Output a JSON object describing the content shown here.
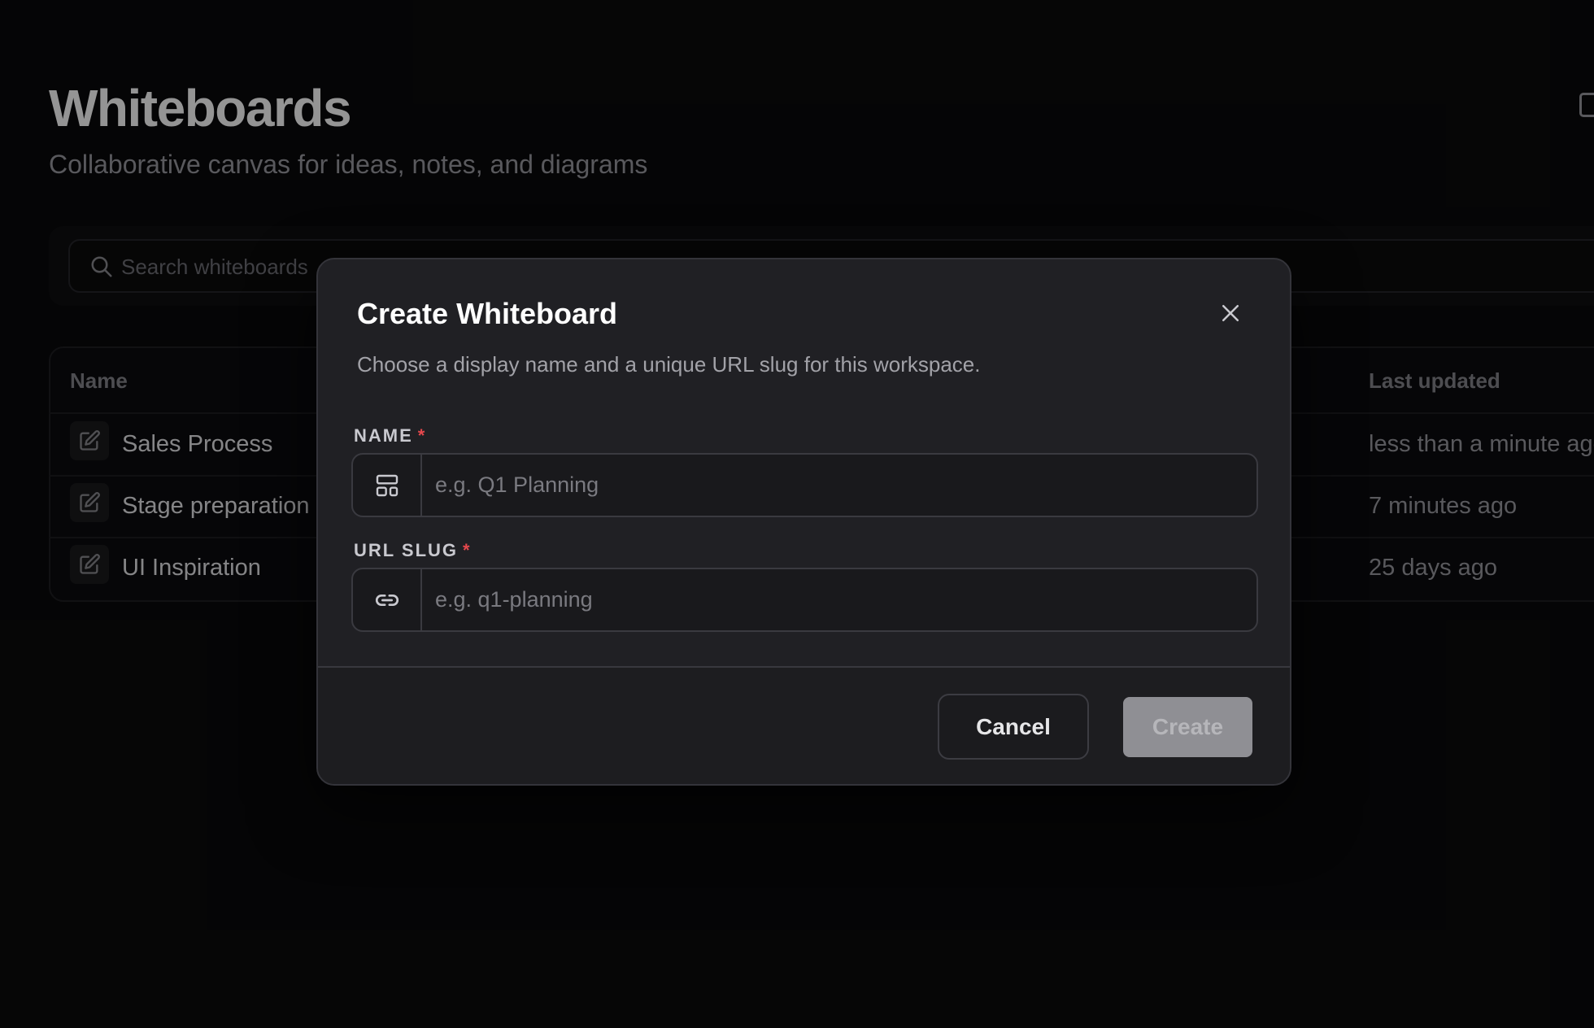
{
  "page": {
    "title": "Whiteboards",
    "subtitle": "Collaborative canvas for ideas, notes, and diagrams"
  },
  "search": {
    "placeholder": "Search whiteboards"
  },
  "table": {
    "columns": {
      "name": "Name",
      "last_updated": "Last updated"
    },
    "rows": [
      {
        "name": "Sales Process",
        "updated": "less than a minute ago",
        "icon": "edit-icon"
      },
      {
        "name": "Stage preparation",
        "updated": "7 minutes ago",
        "icon": "edit-icon"
      },
      {
        "name": "UI Inspiration",
        "updated": "25 days ago",
        "icon": "edit-icon"
      }
    ]
  },
  "modal": {
    "title": "Create Whiteboard",
    "description": "Choose a display name and a unique URL slug for this workspace.",
    "name_field": {
      "label": "NAME",
      "required_mark": "*",
      "placeholder": "e.g. Q1 Planning",
      "value": "",
      "icon": "layout-icon"
    },
    "slug_field": {
      "label": "URL SLUG",
      "required_mark": "*",
      "placeholder": "e.g. q1-planning",
      "value": "",
      "icon": "link-icon"
    },
    "cancel_label": "Cancel",
    "create_label": "Create",
    "create_disabled": true
  },
  "colors": {
    "background": "#0a0a0b",
    "modal_background": "#202024",
    "required": "#e5484d",
    "create_disabled": "#8f8f94"
  }
}
